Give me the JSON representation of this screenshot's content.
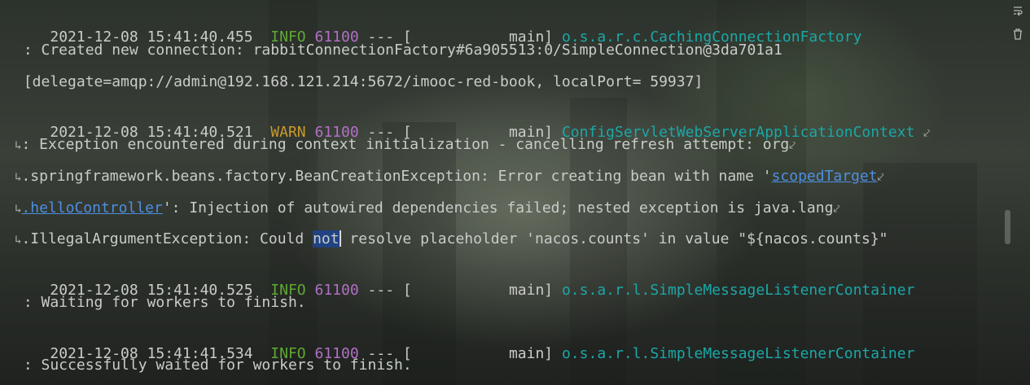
{
  "log": {
    "l1": {
      "ts": "2021-12-08 15:41:40.455",
      "level": "INFO",
      "pid": "61100",
      "sep": "--- [",
      "thread": "main]",
      "logger": "o.s.a.r.c.CachingConnectionFactory"
    },
    "l2": " : Created new connection: rabbitConnectionFactory#6a905513:0/SimpleConnection@3da701a1",
    "l3": " [delegate=amqp://admin@192.168.121.214:5672/imooc-red-book, localPort= 59937]",
    "l4": {
      "ts": "2021-12-08 15:41:40.521",
      "level": "WARN",
      "pid": "61100",
      "sep": "--- [",
      "thread": "main]",
      "logger": "ConfigServletWebServerApplicationContext"
    },
    "l5": ": Exception encountered during context initialization - cancelling refresh attempt: org",
    "l6": {
      "pre": ".springframework.beans.factory.BeanCreationException: Error creating bean with name '",
      "link": "scopedTarget"
    },
    "l7": {
      "link": ".helloController",
      "post": "': Injection of autowired dependencies failed; nested exception is java.lang"
    },
    "l8": {
      "pre": ".IllegalArgumentException: Could ",
      "sel": "not",
      "post": " resolve placeholder 'nacos.counts' in value \"${nacos.counts}\""
    },
    "l9": {
      "ts": "2021-12-08 15:41:40.525",
      "level": "INFO",
      "pid": "61100",
      "sep": "--- [",
      "thread": "main]",
      "logger": "o.s.a.r.l.SimpleMessageListenerContainer"
    },
    "l10": " : Waiting for workers to finish.",
    "l11": {
      "ts": "2021-12-08 15:41:41.534",
      "level": "INFO",
      "pid": "61100",
      "sep": "--- [",
      "thread": "main]",
      "logger": "o.s.a.r.l.SimpleMessageListenerContainer"
    },
    "l12": " : Successfully waited for workers to finish."
  },
  "icons": [
    "soft-wrap-icon",
    "trash-icon",
    "wrap-continuation-icon"
  ],
  "colors": {
    "info": "#5fa834",
    "warn": "#c99a2e",
    "pid": "#b26fc5",
    "logger": "#1ba7a7",
    "link": "#4d8fe0",
    "selection": "#214283"
  }
}
